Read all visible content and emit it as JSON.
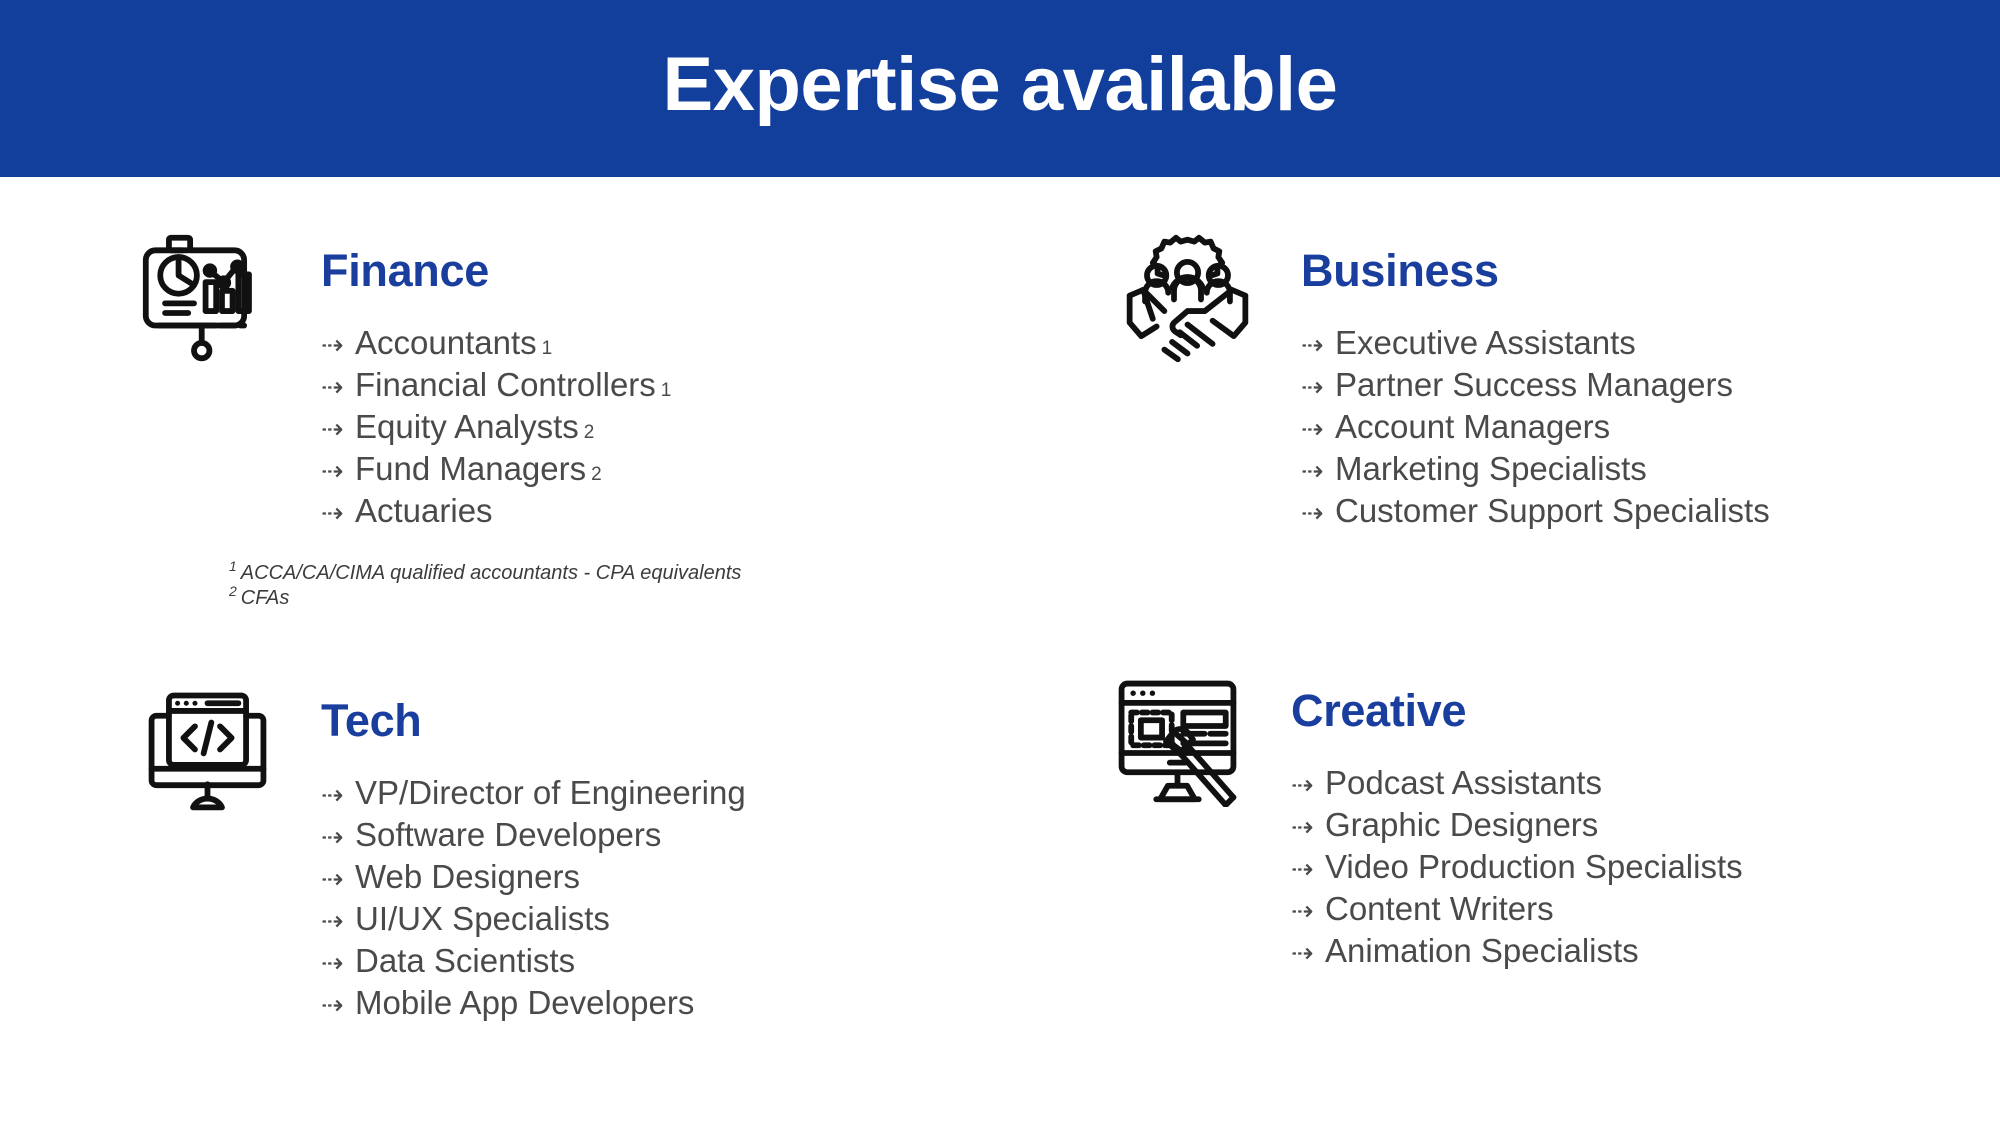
{
  "header": {
    "title": "Expertise available",
    "background_color": "#123E9C",
    "text_color": "#FFFFFF"
  },
  "theme": {
    "accent_blue": "#1A3E9E",
    "body_text": "#4A4A4A",
    "page_background": "#FFFFFF",
    "bullet_glyph": "⇢"
  },
  "categories": [
    {
      "id": "finance",
      "heading": "Finance",
      "icon": "presentation-chart-icon",
      "items": [
        {
          "label": "Accountants",
          "sup": "1"
        },
        {
          "label": "Financial Controllers",
          "sup": "1"
        },
        {
          "label": "Equity Analysts",
          "sup": "2"
        },
        {
          "label": "Fund Managers",
          "sup": "2"
        },
        {
          "label": "Actuaries",
          "sup": ""
        }
      ],
      "footnotes": [
        {
          "mark": "1",
          "text": "ACCA/CA/CIMA qualified accountants - CPA equivalents"
        },
        {
          "mark": "2",
          "text": "CFAs"
        }
      ]
    },
    {
      "id": "business",
      "heading": "Business",
      "icon": "handshake-team-gear-icon",
      "items": [
        {
          "label": "Executive Assistants",
          "sup": ""
        },
        {
          "label": "Partner Success Managers",
          "sup": ""
        },
        {
          "label": "Account Managers",
          "sup": ""
        },
        {
          "label": "Marketing Specialists",
          "sup": ""
        },
        {
          "label": "Customer Support Specialists",
          "sup": ""
        }
      ],
      "footnotes": []
    },
    {
      "id": "tech",
      "heading": "Tech",
      "icon": "monitor-code-icon",
      "items": [
        {
          "label": "VP/Director of Engineering",
          "sup": ""
        },
        {
          "label": "Software Developers",
          "sup": ""
        },
        {
          "label": "Web Designers",
          "sup": ""
        },
        {
          "label": "UI/UX Specialists",
          "sup": ""
        },
        {
          "label": "Data Scientists",
          "sup": ""
        },
        {
          "label": "Mobile App Developers",
          "sup": ""
        }
      ],
      "footnotes": []
    },
    {
      "id": "creative",
      "heading": "Creative",
      "icon": "monitor-paintbrush-icon",
      "items": [
        {
          "label": "Podcast Assistants",
          "sup": ""
        },
        {
          "label": "Graphic Designers",
          "sup": ""
        },
        {
          "label": "Video Production Specialists",
          "sup": ""
        },
        {
          "label": "Content Writers",
          "sup": ""
        },
        {
          "label": "Animation Specialists",
          "sup": ""
        }
      ],
      "footnotes": []
    }
  ]
}
